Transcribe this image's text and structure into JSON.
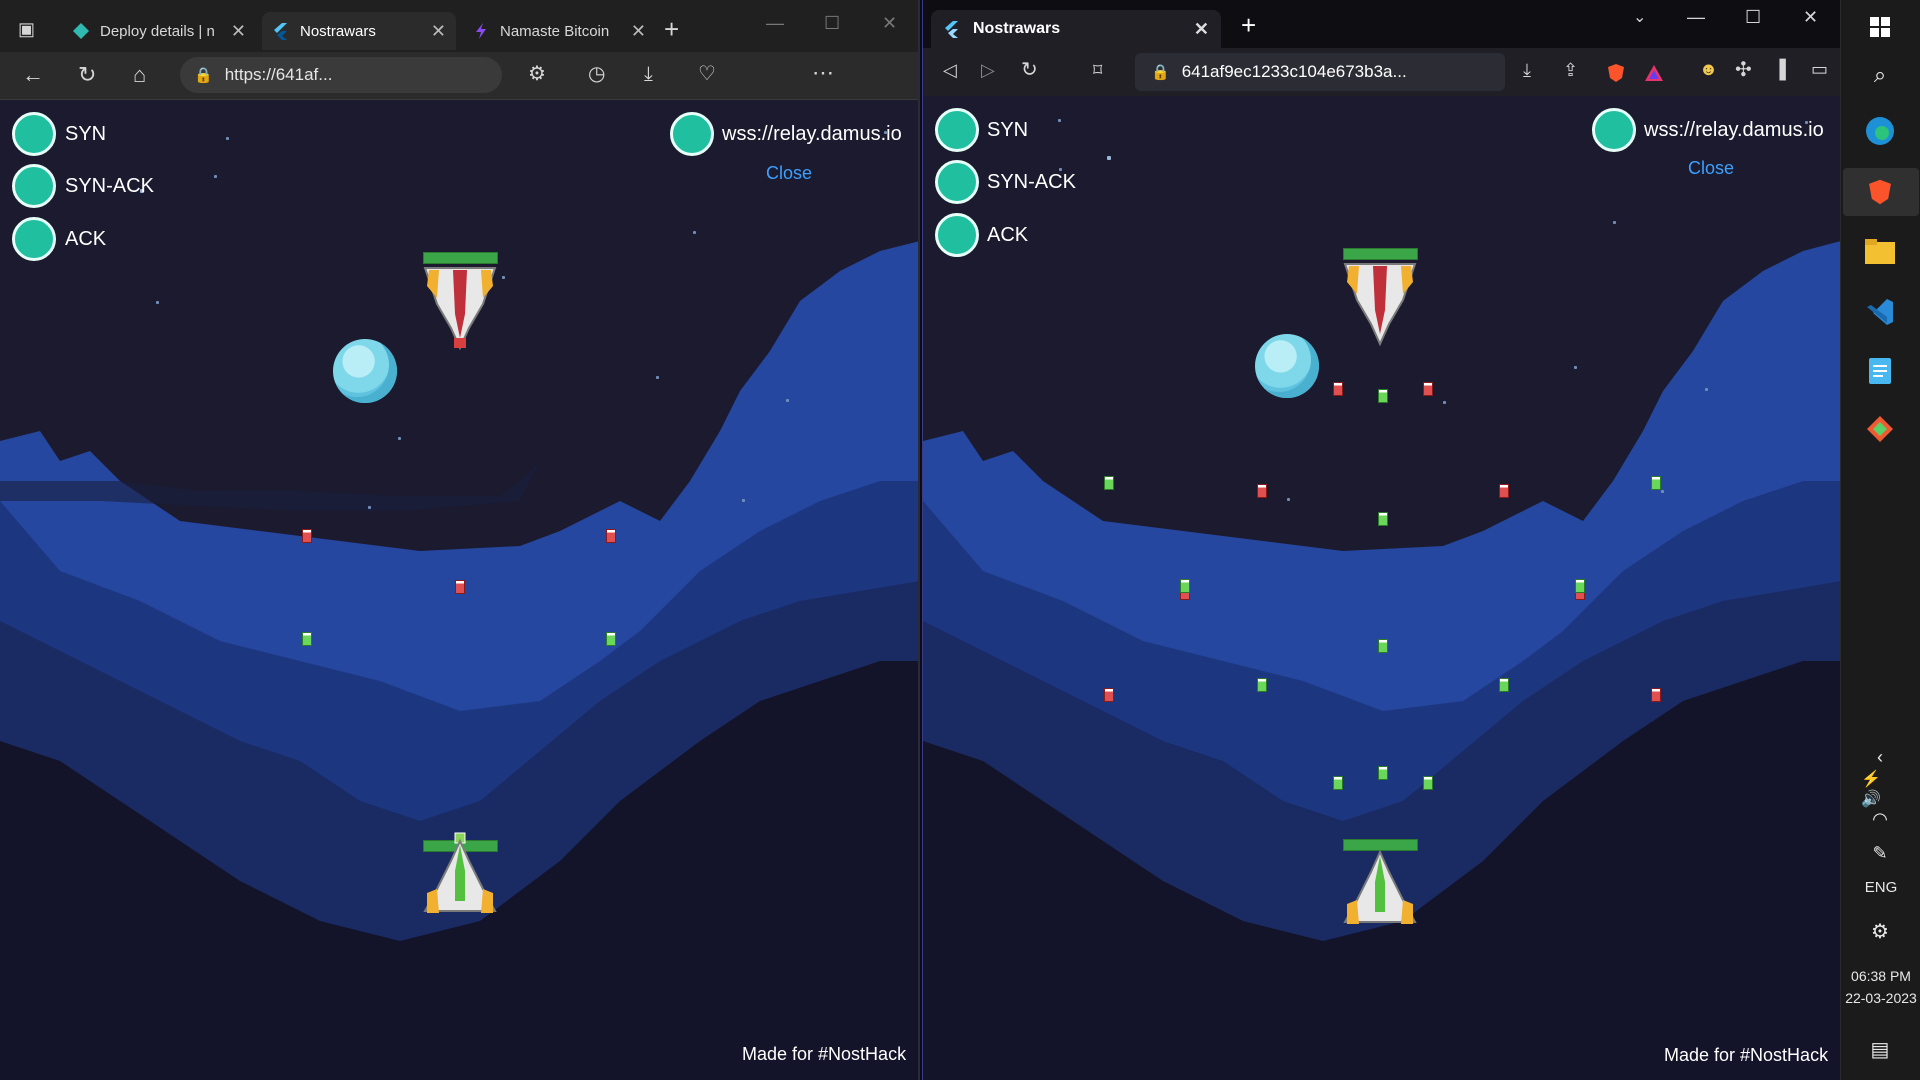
{
  "left_browser": {
    "tabs": [
      {
        "label": "Deploy details | n",
        "icon": "netlify-icon"
      },
      {
        "label": "Nostrawars",
        "icon": "flutter-icon"
      },
      {
        "label": "Namaste Bitcoin",
        "icon": "lightning-icon"
      }
    ],
    "address": "https://641af...",
    "game": {
      "handshake": [
        "SYN",
        "SYN-ACK",
        "ACK"
      ],
      "relay": "wss://relay.damus.io",
      "close": "Close",
      "footer": "Made for #NostHack"
    }
  },
  "right_browser": {
    "tab": {
      "label": "Nostrawars",
      "icon": "flutter-icon"
    },
    "address": "641af9ec1233c104e673b3a...",
    "game": {
      "handshake": [
        "SYN",
        "SYN-ACK",
        "ACK"
      ],
      "relay": "wss://relay.damus.io",
      "close": "Close",
      "footer": "Made for #NostHack"
    }
  },
  "taskbar": {
    "language": "ENG",
    "time": "06:38 PM",
    "date": "22-03-2023"
  },
  "colors": {
    "status_dot": "#1fbf9f",
    "link": "#3da0ff",
    "sky": "#1b1a2e",
    "cloud_light": "#2b4fa0",
    "cloud_dark": "#13142a"
  }
}
